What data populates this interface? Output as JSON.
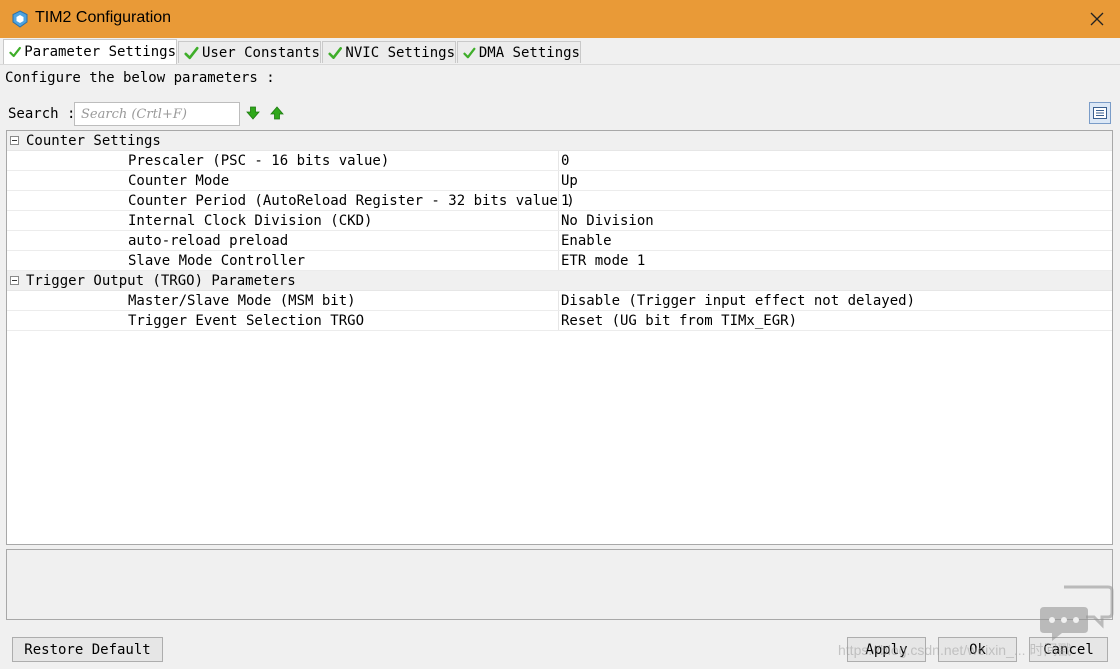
{
  "window": {
    "title": "TIM2 Configuration",
    "app_icon": "cube-shield-icon",
    "close_icon": "close-icon",
    "colors": {
      "titlebar": "#e99a37",
      "check": "#3fae2a",
      "arrow": "#2fa81a"
    }
  },
  "tabs": [
    {
      "label": "Parameter Settings",
      "active": true
    },
    {
      "label": "User Constants",
      "active": false
    },
    {
      "label": "NVIC Settings",
      "active": false
    },
    {
      "label": "DMA Settings",
      "active": false
    }
  ],
  "configure_text": "Configure the below parameters :",
  "search": {
    "label": "Search :",
    "placeholder": "Search (Crtl+F)"
  },
  "groups": [
    {
      "title": "Counter Settings",
      "params": [
        {
          "name": "Prescaler (PSC - 16 bits value)",
          "value": "0"
        },
        {
          "name": "Counter Mode",
          "value": "Up"
        },
        {
          "name": "Counter Period (AutoReload Register - 32 bits value )",
          "value": "1"
        },
        {
          "name": "Internal Clock Division (CKD)",
          "value": "No Division"
        },
        {
          "name": "auto-reload preload",
          "value": "Enable"
        },
        {
          "name": "Slave Mode Controller",
          "value": "ETR mode 1"
        }
      ]
    },
    {
      "title": "Trigger Output (TRGO) Parameters",
      "params": [
        {
          "name": "Master/Slave Mode (MSM bit)",
          "value": "Disable (Trigger input effect not delayed)"
        },
        {
          "name": "Trigger Event Selection TRGO",
          "value": "Reset (UG bit from TIMx_EGR)"
        }
      ]
    }
  ],
  "buttons": {
    "restore": "Restore Default",
    "apply": "Apply",
    "ok": "Ok",
    "cancel": "Cancel"
  },
  "watermark": "https://blog.csdn.net/weixin_... 时间戳"
}
